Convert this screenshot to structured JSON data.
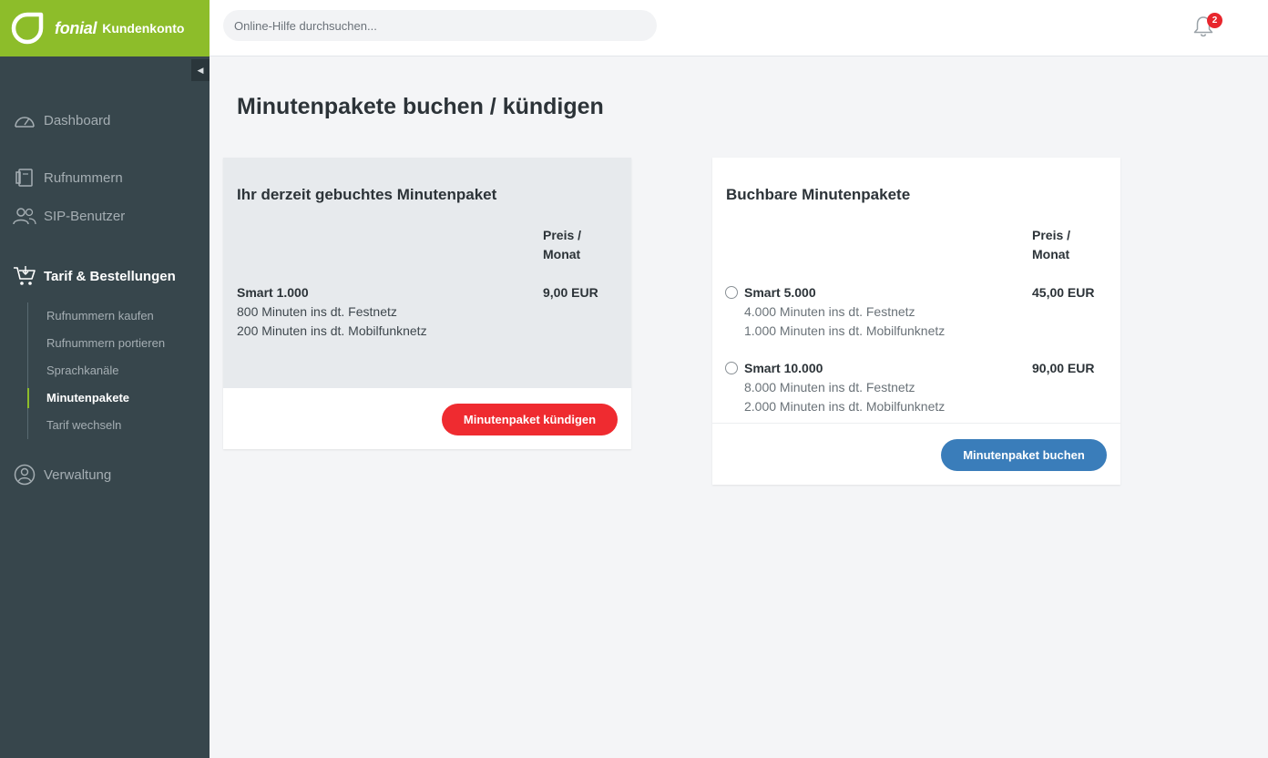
{
  "brand": {
    "name": "fonial",
    "subtitle": "Kundenkonto",
    "color": "#8dbd2a"
  },
  "search": {
    "placeholder": "Online-Hilfe durchsuchen..."
  },
  "notifications": {
    "count": "2"
  },
  "sidebar": {
    "collapse_icon": "◀",
    "items": [
      {
        "label": "Dashboard",
        "icon": "speedometer-icon"
      },
      {
        "label": "Rufnummern",
        "icon": "phone-book-icon"
      },
      {
        "label": "SIP-Benutzer",
        "icon": "users-icon"
      },
      {
        "label": "Tarif & Bestellungen",
        "icon": "cart-icon",
        "active": true
      },
      {
        "label": "Verwaltung",
        "icon": "user-circle-icon"
      }
    ],
    "sub_items": [
      {
        "label": "Rufnummern kaufen"
      },
      {
        "label": "Rufnummern portieren"
      },
      {
        "label": "Sprachkanäle"
      },
      {
        "label": "Minutenpakete",
        "active": true
      },
      {
        "label": "Tarif wechseln"
      }
    ]
  },
  "page": {
    "title": "Minutenpakete buchen / kündigen"
  },
  "current_package": {
    "title": "Ihr derzeit gebuchtes Minutenpaket",
    "price_header": [
      "Preis /",
      "Monat"
    ],
    "name": "Smart 1.000",
    "lines": [
      "800 Minuten ins dt. Festnetz",
      "200 Minuten ins dt. Mobilfunknetz"
    ],
    "price": "9,00 EUR",
    "cancel_label": "Minutenpaket kündigen"
  },
  "bookable_packages": {
    "title": "Buchbare Minutenpakete",
    "price_header": [
      "Preis /",
      "Monat"
    ],
    "packages": [
      {
        "name": "Smart 5.000",
        "lines": [
          "4.000 Minuten ins dt. Festnetz",
          "1.000 Minuten ins dt. Mobilfunknetz"
        ],
        "price": "45,00 EUR"
      },
      {
        "name": "Smart 10.000",
        "lines": [
          "8.000 Minuten ins dt. Festnetz",
          "2.000 Minuten ins dt. Mobilfunknetz"
        ],
        "price": "90,00 EUR"
      }
    ],
    "book_label": "Minutenpaket buchen"
  },
  "colors": {
    "sidebar_bg": "#37464c",
    "cancel_button": "#ef2b30",
    "book_button": "#3a7dba",
    "notification_badge": "#e8262d"
  }
}
